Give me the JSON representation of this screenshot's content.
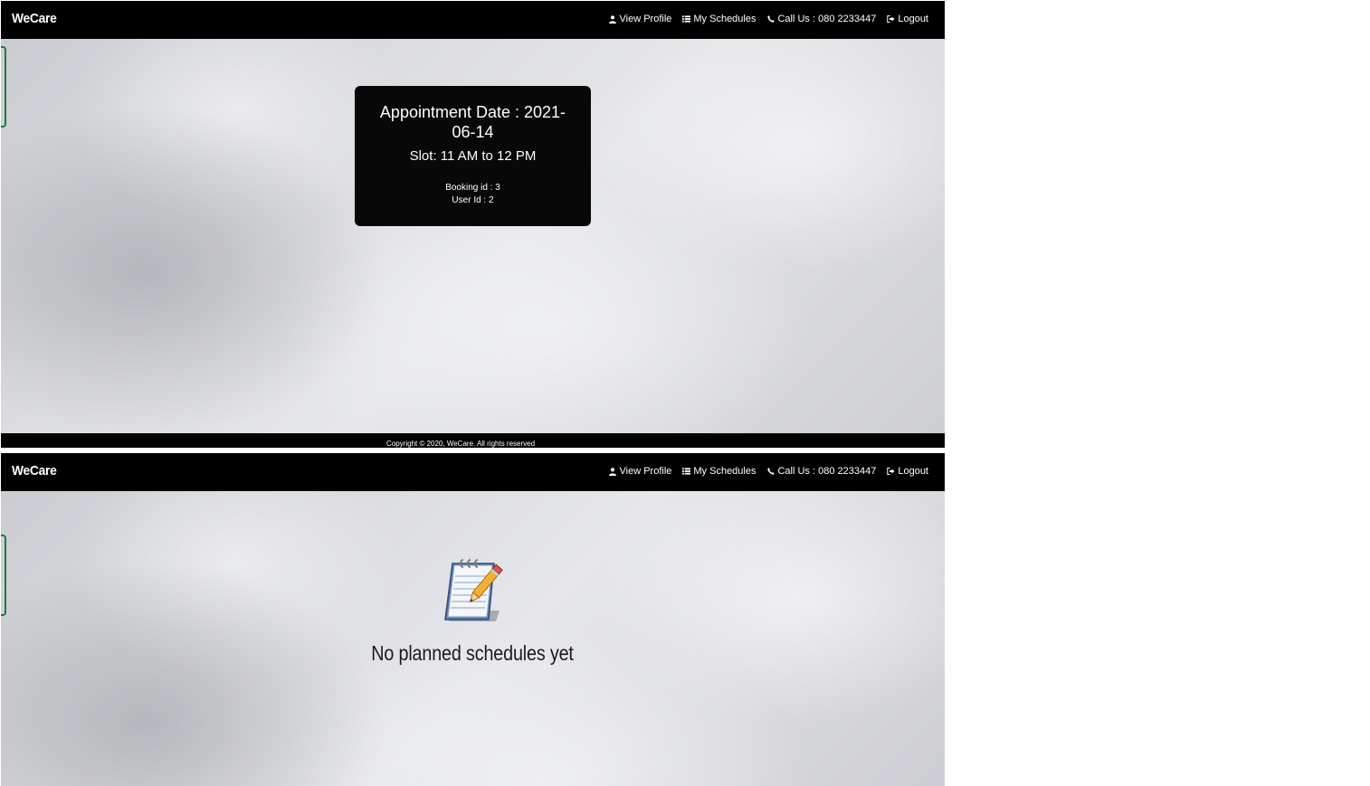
{
  "brand": "WeCare",
  "nav": {
    "view_profile": "View Profile",
    "my_schedules": "My Schedules",
    "call_us": "Call Us : 080 2233447",
    "logout": "Logout"
  },
  "nav_icons": [
    "user-icon",
    "list-icon",
    "phone-icon",
    "logout-icon"
  ],
  "appointment": {
    "date_label": "Appointment Date : 2021-06-14",
    "slot": "Slot: 11 AM to 12 PM",
    "booking_id": "Booking id : 3",
    "user_id": "User Id : 2"
  },
  "footer": {
    "copyright": "Copyright © 2020, WeCare. All rights reserved"
  },
  "empty_state": {
    "icon": "notepad-pencil-icon",
    "message": "No planned schedules yet"
  },
  "colors": {
    "navbar": "#000000",
    "card": "#080808",
    "side_tab_border": "#1f7a3f"
  }
}
